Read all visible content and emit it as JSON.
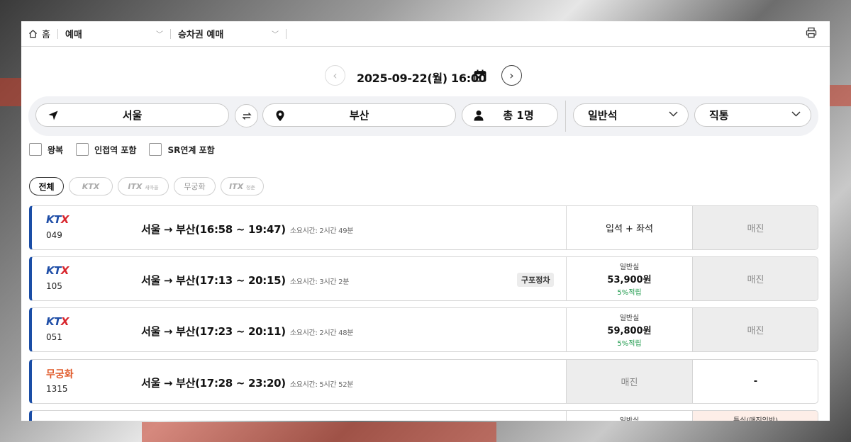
{
  "nav": {
    "home_label": "홈",
    "crumb1": "예매",
    "crumb2": "승차권 예매"
  },
  "search": {
    "date": "2025-09-22(월) 16:00",
    "origin": "서울",
    "destination": "부산",
    "passengers": "총 1명",
    "seat_class": "일반석",
    "trip_type": "직통"
  },
  "checks": [
    "왕복",
    "인접역 포함",
    "SR연계 포함"
  ],
  "chips": {
    "all": "전체",
    "ktx": "KTX",
    "ktx_saemaeul": "ITX",
    "ktx_saemaeul_sub": "새마을",
    "mugunghwa": "무궁화",
    "itx_cheongchun": "ITX",
    "itx_cheongchun_sub": "청춘"
  },
  "trains": [
    {
      "brand": "KTX",
      "number": "049",
      "route": "서울 → 부산(16:58 ~ 19:47)",
      "duration": "소요시간: 2시간 49분",
      "badge": "",
      "col1_type": "seat",
      "col1_text": "입석 + 좌석",
      "col2": "매진"
    },
    {
      "brand": "KTX",
      "number": "105",
      "route": "서울 → 부산(17:13 ~ 20:15)",
      "duration": "소요시간: 3시간 2분",
      "badge": "구포정차",
      "col1_type": "price",
      "col1_label": "일반실",
      "col1_price": "53,900원",
      "col1_points": "5%적립",
      "col2": "매진"
    },
    {
      "brand": "KTX",
      "number": "051",
      "route": "서울 → 부산(17:23 ~ 20:11)",
      "duration": "소요시간: 2시간 48분",
      "badge": "",
      "col1_type": "price",
      "col1_label": "일반실",
      "col1_price": "59,800원",
      "col1_points": "5%적립",
      "col2": "매진"
    },
    {
      "brand": "무궁화",
      "number": "1315",
      "route": "서울 → 부산(17:28 ~ 23:20)",
      "duration": "소요시간: 5시간 52분",
      "badge": "",
      "col1_type": "soldout",
      "col1_text": "매진",
      "col2": "-"
    },
    {
      "brand": "",
      "number": "",
      "route": "",
      "duration": "",
      "badge": "",
      "col1_type": "price",
      "col1_label": "일반실",
      "col1_price": "",
      "col1_points": "",
      "col2": "특실(매진임박)"
    }
  ]
}
